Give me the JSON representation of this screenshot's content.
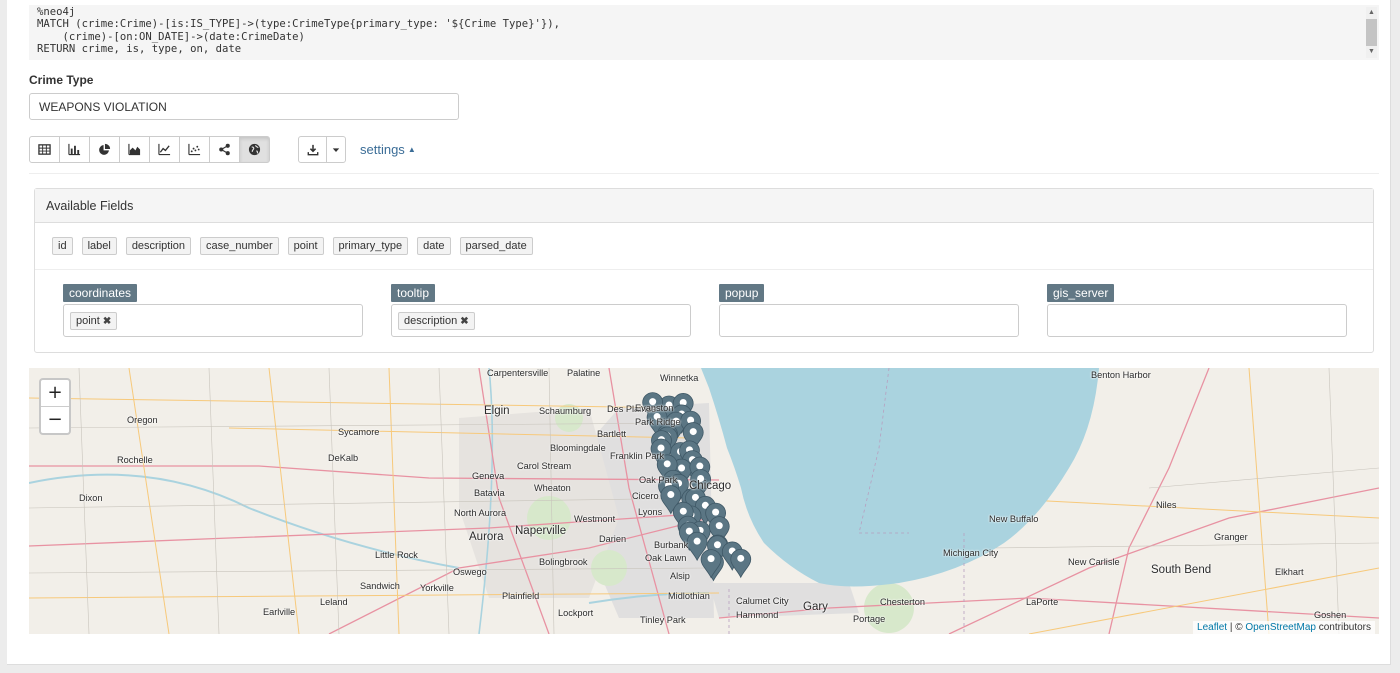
{
  "editor": {
    "code": "%neo4j\nMATCH (crime:Crime)-[is:IS_TYPE]->(type:CrimeType{primary_type: '${Crime Type}'}),\n    (crime)-[on:ON_DATE]->(date:CrimeDate)\nRETURN crime, is, type, on, date"
  },
  "form": {
    "label": "Crime Type",
    "value": "WEAPONS VIOLATION"
  },
  "toolbar": {
    "viz_buttons": [
      "table-icon",
      "bar-chart-icon",
      "pie-chart-icon",
      "area-chart-icon",
      "line-chart-icon",
      "scatter-chart-icon",
      "network-icon",
      "globe-icon"
    ],
    "active": "globe-icon",
    "settings_label": "settings"
  },
  "settings_panel": {
    "title": "Available Fields",
    "fields": [
      "id",
      "label",
      "description",
      "case_number",
      "point",
      "primary_type",
      "date",
      "parsed_date"
    ],
    "groups": [
      {
        "name": "coordinates",
        "values": [
          "point"
        ]
      },
      {
        "name": "tooltip",
        "values": [
          "description"
        ]
      },
      {
        "name": "popup",
        "values": []
      },
      {
        "name": "gis_server",
        "values": []
      }
    ]
  },
  "map": {
    "water_color": "#aad3df",
    "marker_color": "#5b7684",
    "places": [
      "Carpentersville",
      "Palatine",
      "Winnetka",
      "Benton Harbor",
      "Elgin",
      "Schaumburg",
      "Des Plaines",
      "Evanston",
      "Oregon",
      "Sycamore",
      "Bartlett",
      "Park Ridge",
      "DeKalb",
      "Bloomingdale",
      "Rochelle",
      "Carol Stream",
      "Franklin Park",
      "Oak Park",
      "Geneva",
      "Batavia",
      "Wheaton",
      "Cicero",
      "Chicago",
      "Dixon",
      "North Aurora",
      "Westmont",
      "Lyons",
      "Niles",
      "Aurora",
      "Naperville",
      "Darien",
      "New Buffalo",
      "Burbank",
      "Little Rock",
      "Bolingbrook",
      "Oak Lawn",
      "Michigan City",
      "Granger",
      "Oswego",
      "Alsip",
      "New Carlisle",
      "South Bend",
      "Elkhart",
      "Sandwich",
      "Yorkville",
      "Plainfield",
      "Midlothian",
      "Calumet City",
      "Gary",
      "Chesterton",
      "LaPorte",
      "Earlville",
      "Leland",
      "Lockport",
      "Tinley Park",
      "Hammond",
      "Portage",
      "Goshen"
    ],
    "attribution": {
      "leaflet": "Leaflet",
      "sep": " | © ",
      "osm": "OpenStreetMap",
      "tail": " contributors"
    },
    "zoom_in": "+",
    "zoom_out": "−",
    "marker_count_visible": 40
  }
}
